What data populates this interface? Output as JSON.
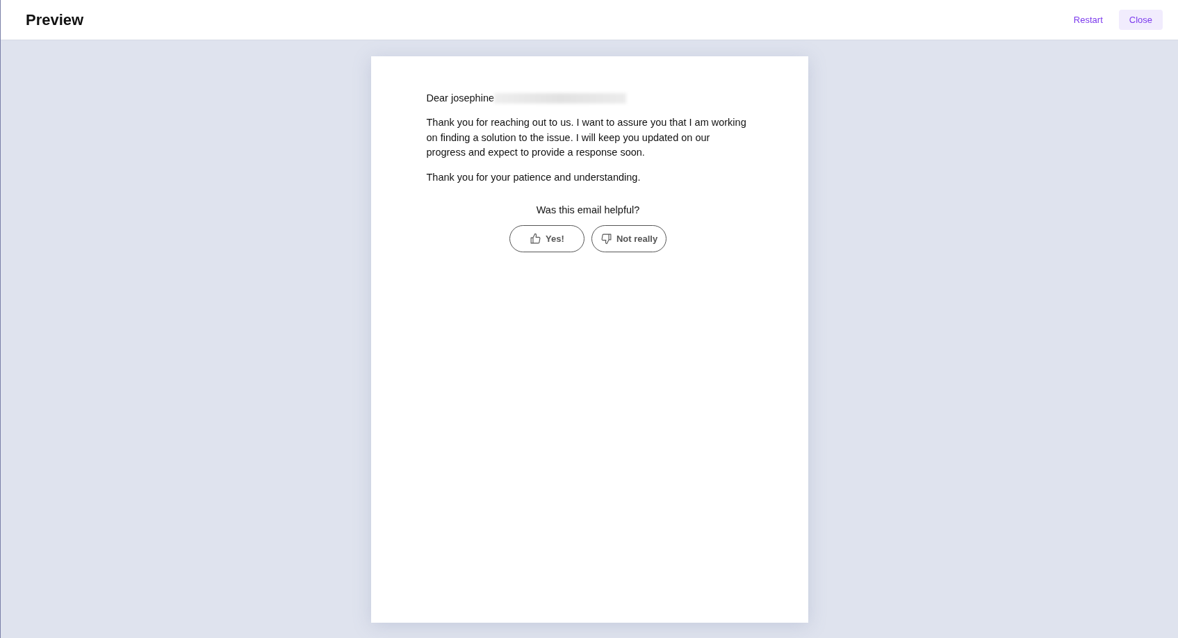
{
  "header": {
    "title": "Preview",
    "actions": [
      {
        "label": "Restart",
        "kind": "link"
      },
      {
        "label": "Close",
        "kind": "filled"
      }
    ]
  },
  "email": {
    "greeting": "Dear josephine",
    "redacted": true,
    "paragraphs": [
      "Thank you for reaching out to us. I want to assure you that I am working on finding a solution to the issue. I will keep you updated on our progress and expect to provide a response soon.",
      "Thank you for your patience and understanding."
    ]
  },
  "feedback": {
    "question": "Was this email helpful?",
    "buttons": [
      {
        "label": "Yes!",
        "kind": "thumbs-up"
      },
      {
        "label": "Not really",
        "kind": "thumbs-down"
      }
    ]
  }
}
